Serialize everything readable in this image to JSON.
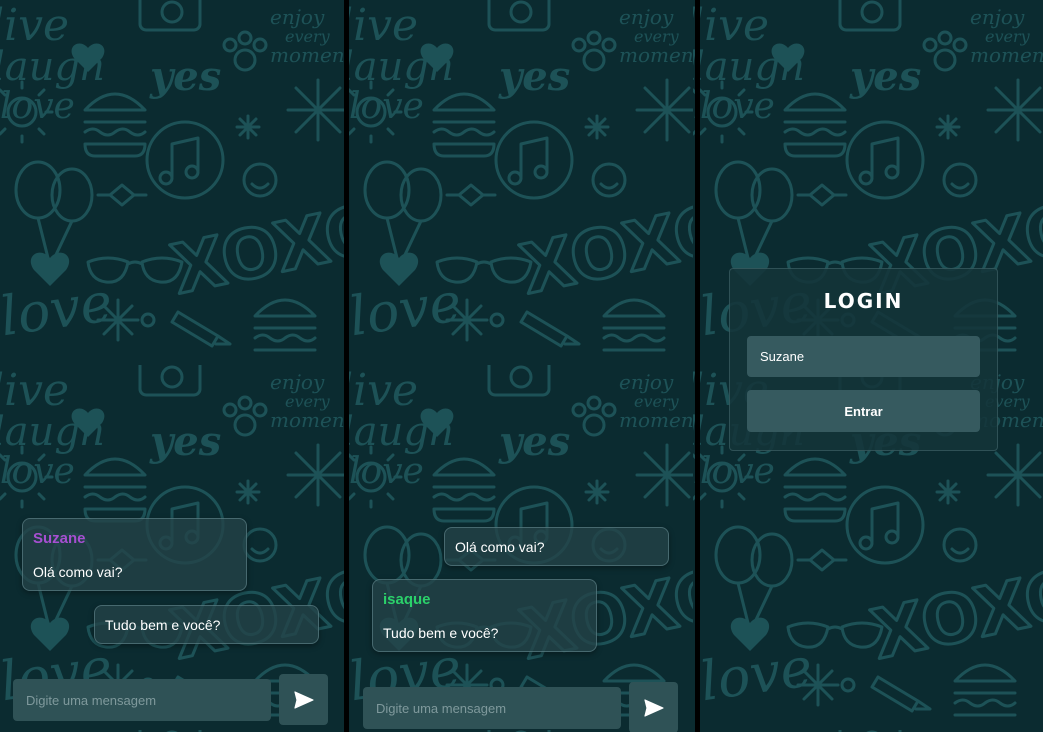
{
  "colors": {
    "background": "#0b2b30",
    "doodle": "#1a4d52",
    "bubble": "#244248",
    "input": "#2f5256",
    "sender_suzane": "#a64fd1",
    "sender_isaque": "#2bd16a"
  },
  "chat_suzane": {
    "messages": [
      {
        "sender": "Suzane",
        "text": "Olá como vai?"
      },
      {
        "text": "Tudo bem e você?"
      }
    ],
    "input": {
      "placeholder": "Digite uma mensagem",
      "value": ""
    },
    "send_icon": "send-icon"
  },
  "chat_isaque": {
    "messages": [
      {
        "text": "Olá como vai?"
      },
      {
        "sender": "isaque",
        "text": "Tudo bem e você?"
      }
    ],
    "input": {
      "placeholder": "Digite uma mensagem",
      "value": ""
    },
    "send_icon": "send-icon"
  },
  "login": {
    "title": "LOGIN",
    "name_value": "Suzane",
    "button_label": "Entrar"
  },
  "doodle_texts": [
    "live",
    "laugh",
    "love",
    "yes",
    "XOXO",
    "enjoy",
    "every",
    "moment"
  ]
}
